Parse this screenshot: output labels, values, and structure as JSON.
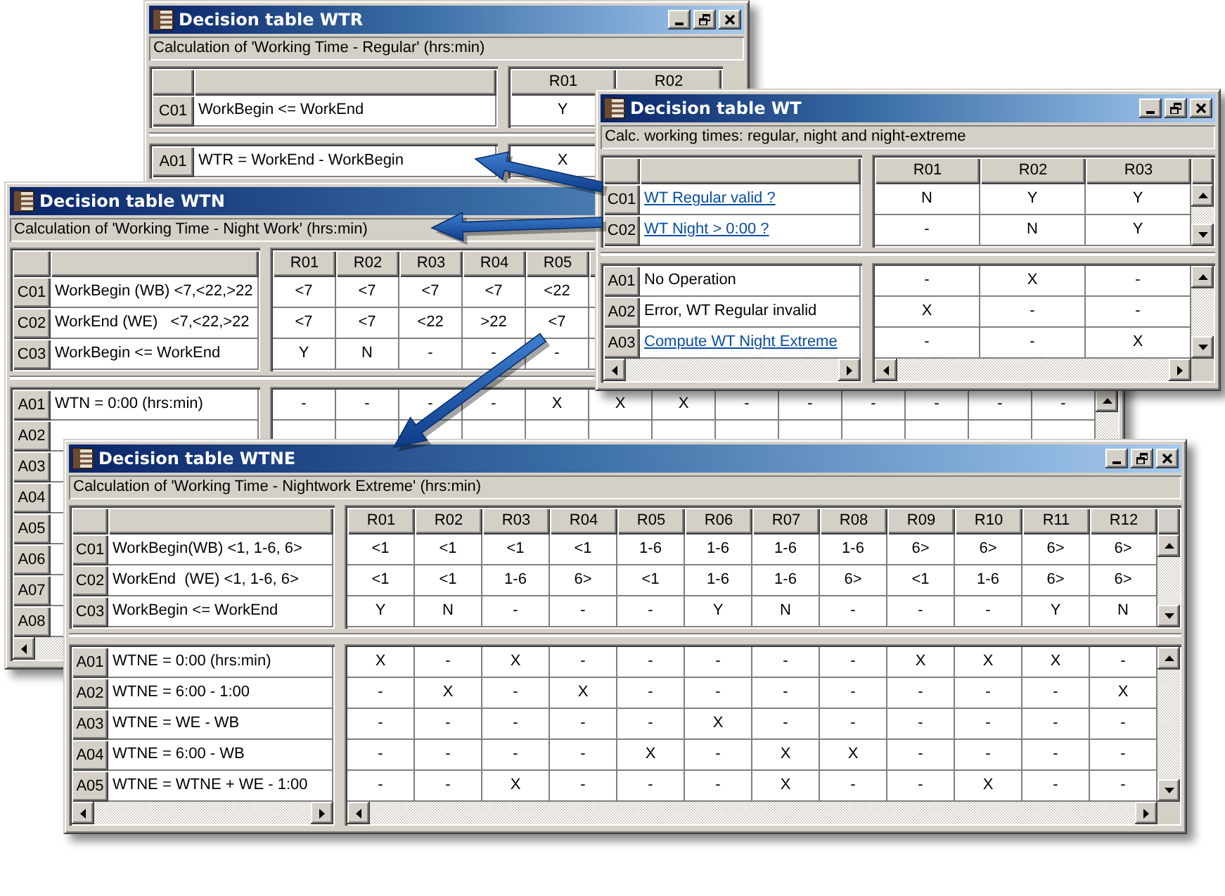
{
  "windows": [
    {
      "title": "Decision table WTR",
      "description": "Calculation of 'Working Time - Regular' (hrs:min)",
      "columns": [
        "R01",
        "R02"
      ],
      "conditions": [
        {
          "id": "C01",
          "text": "WorkBegin <= WorkEnd",
          "values": [
            "Y"
          ]
        }
      ],
      "actions": [
        {
          "id": "A01",
          "text": "WTR = WorkEnd - WorkBegin",
          "values": [
            "X"
          ]
        }
      ]
    },
    {
      "title": "Decision table WTN",
      "description": "Calculation of 'Working Time - Night Work' (hrs:min)",
      "columns": [
        "R01",
        "R02",
        "R03",
        "R04",
        "R05"
      ],
      "conditions": [
        {
          "id": "C01",
          "text": "WorkBegin (WB) <7,<22,>22",
          "values": [
            "<7",
            "<7",
            "<7",
            "<7",
            "<22"
          ]
        },
        {
          "id": "C02",
          "text": "WorkEnd (WE)   <7,<22,>22",
          "values": [
            "<7",
            "<7",
            "<22",
            ">22",
            "<7"
          ]
        },
        {
          "id": "C03",
          "text": "WorkBegin <= WorkEnd",
          "values": [
            "Y",
            "N",
            "-",
            "-",
            "-"
          ]
        }
      ],
      "actions": [
        {
          "id": "A01",
          "text": "WTN = 0:00 (hrs:min)",
          "values": [
            "-",
            "-",
            "-",
            "-",
            "X",
            "X",
            "X",
            "-",
            "-",
            "-",
            "-",
            "-",
            "-"
          ]
        },
        {
          "id": "A02"
        },
        {
          "id": "A03"
        },
        {
          "id": "A04"
        },
        {
          "id": "A05"
        },
        {
          "id": "A06"
        },
        {
          "id": "A07"
        },
        {
          "id": "A08"
        }
      ]
    },
    {
      "title": "Decision table WT",
      "description": "Calc. working times: regular, night and night-extreme",
      "columns": [
        "R01",
        "R02",
        "R03"
      ],
      "conditions": [
        {
          "id": "C01",
          "text": "WT Regular valid ?",
          "link": true,
          "values": [
            "N",
            "Y",
            "Y"
          ]
        },
        {
          "id": "C02",
          "text": "WT Night > 0:00 ?",
          "link": true,
          "values": [
            "-",
            "N",
            "Y"
          ]
        }
      ],
      "actions": [
        {
          "id": "A01",
          "text": "No Operation",
          "link": false,
          "values": [
            "-",
            "X",
            "-"
          ]
        },
        {
          "id": "A02",
          "text": "Error, WT Regular invalid",
          "link": false,
          "values": [
            "X",
            "-",
            "-"
          ]
        },
        {
          "id": "A03",
          "text": "Compute WT Night Extreme",
          "link": true,
          "values": [
            "-",
            "-",
            "X"
          ]
        }
      ]
    },
    {
      "title": "Decision table WTNE",
      "description": "Calculation of 'Working Time - Nightwork Extreme' (hrs:min)",
      "columns": [
        "R01",
        "R02",
        "R03",
        "R04",
        "R05",
        "R06",
        "R07",
        "R08",
        "R09",
        "R10",
        "R11",
        "R12"
      ],
      "conditions": [
        {
          "id": "C01",
          "text": "WorkBegin(WB) <1, 1-6, 6>",
          "values": [
            "<1",
            "<1",
            "<1",
            "<1",
            "1-6",
            "1-6",
            "1-6",
            "1-6",
            "6>",
            "6>",
            "6>",
            "6>"
          ]
        },
        {
          "id": "C02",
          "text": "WorkEnd  (WE) <1, 1-6, 6>",
          "values": [
            "<1",
            "<1",
            "1-6",
            "6>",
            "<1",
            "1-6",
            "1-6",
            "6>",
            "<1",
            "1-6",
            "6>",
            "6>"
          ]
        },
        {
          "id": "C03",
          "text": "WorkBegin <= WorkEnd",
          "values": [
            "Y",
            "N",
            "-",
            "-",
            "-",
            "Y",
            "N",
            "-",
            "-",
            "-",
            "Y",
            "N"
          ]
        }
      ],
      "actions": [
        {
          "id": "A01",
          "text": "WTNE = 0:00 (hrs:min)",
          "values": [
            "X",
            "-",
            "X",
            "-",
            "-",
            "-",
            "-",
            "-",
            "X",
            "X",
            "X",
            "-"
          ]
        },
        {
          "id": "A02",
          "text": "WTNE = 6:00 - 1:00",
          "values": [
            "-",
            "X",
            "-",
            "X",
            "-",
            "-",
            "-",
            "-",
            "-",
            "-",
            "-",
            "X"
          ]
        },
        {
          "id": "A03",
          "text": "WTNE = WE - WB",
          "values": [
            "-",
            "-",
            "-",
            "-",
            "-",
            "X",
            "-",
            "-",
            "-",
            "-",
            "-",
            "-"
          ]
        },
        {
          "id": "A04",
          "text": "WTNE = 6:00 - WB",
          "values": [
            "-",
            "-",
            "-",
            "-",
            "X",
            "-",
            "X",
            "X",
            "-",
            "-",
            "-",
            "-"
          ]
        },
        {
          "id": "A05",
          "text": "WTNE = WTNE + WE - 1:00",
          "values": [
            "-",
            "-",
            "X",
            "-",
            "-",
            "-",
            "X",
            "-",
            "-",
            "X",
            "-",
            "-"
          ]
        }
      ]
    }
  ]
}
